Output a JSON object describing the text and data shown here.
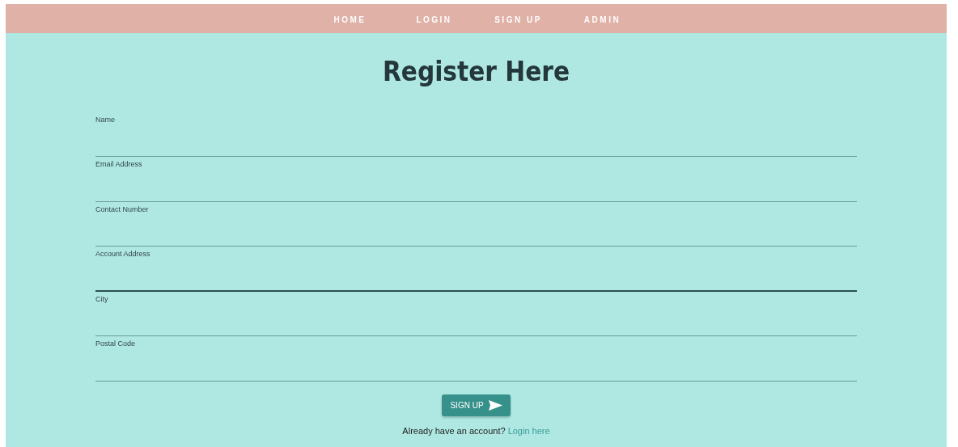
{
  "nav": [
    {
      "label": "HOME"
    },
    {
      "label": "LOGIN"
    },
    {
      "label": "SIGN UP"
    },
    {
      "label": "ADMIN"
    }
  ],
  "title": "Register Here",
  "fields": [
    {
      "label": "Name",
      "focused": false
    },
    {
      "label": "Email Address",
      "focused": false
    },
    {
      "label": "Contact Number",
      "focused": false
    },
    {
      "label": "Account Address",
      "focused": true
    },
    {
      "label": "City",
      "focused": false
    },
    {
      "label": "Postal Code",
      "focused": false
    }
  ],
  "submit": {
    "label": "SIGN UP"
  },
  "footer": {
    "text": "Already have an account?",
    "link": "Login here"
  }
}
